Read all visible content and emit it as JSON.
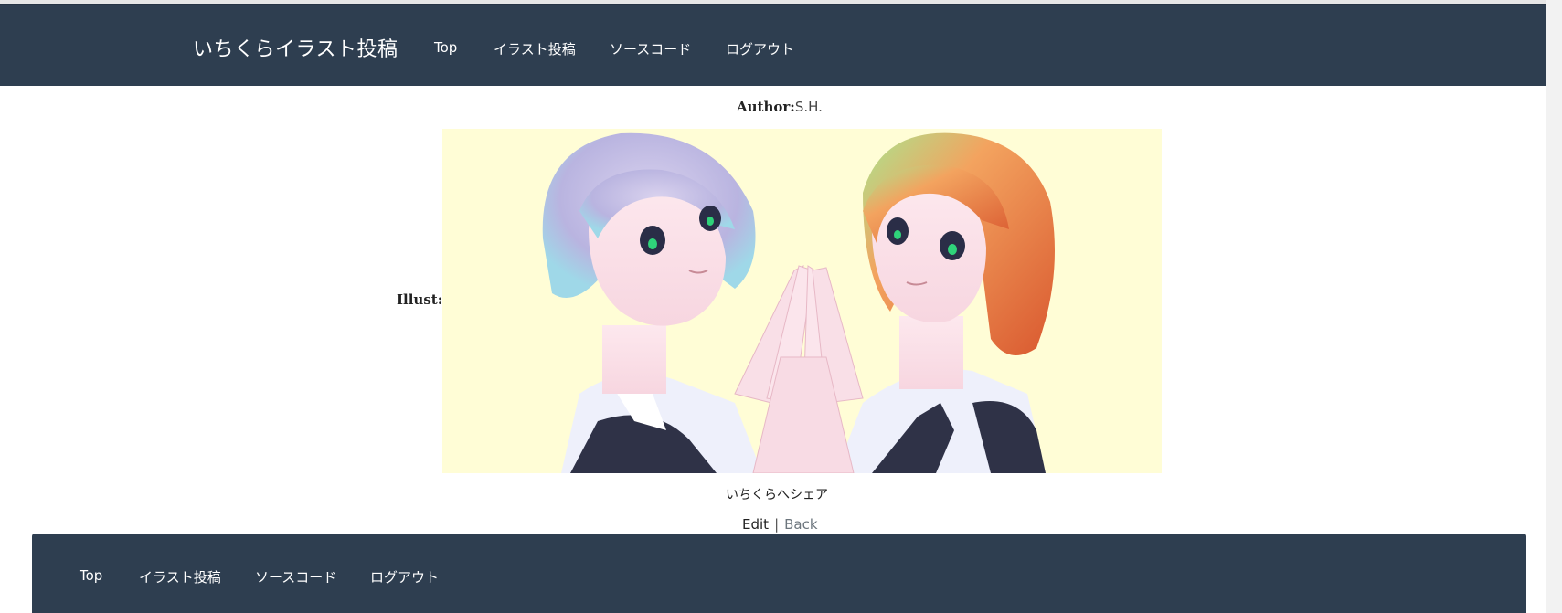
{
  "header": {
    "brand": "いちくらイラスト投稿",
    "nav": [
      {
        "label": "Top"
      },
      {
        "label": "イラスト投稿"
      },
      {
        "label": "ソースコード"
      },
      {
        "label": "ログアウト"
      }
    ]
  },
  "post": {
    "author_label": "Author:",
    "author_value": "S.H.",
    "illust_label": "Illust:",
    "illustration_icon": "anime-illustration-two-girls-touching-hands",
    "share_label": "いちくらへシェア",
    "edit_label": "Edit",
    "separator": "|",
    "back_label": "Back"
  },
  "footer": {
    "nav": [
      {
        "label": "Top"
      },
      {
        "label": "イラスト投稿"
      },
      {
        "label": "ソースコード"
      },
      {
        "label": "ログアウト"
      }
    ]
  },
  "colors": {
    "navbar_bg": "#2e3e50",
    "illust_bg": "#fffdd6",
    "back_link": "#6c757d"
  }
}
